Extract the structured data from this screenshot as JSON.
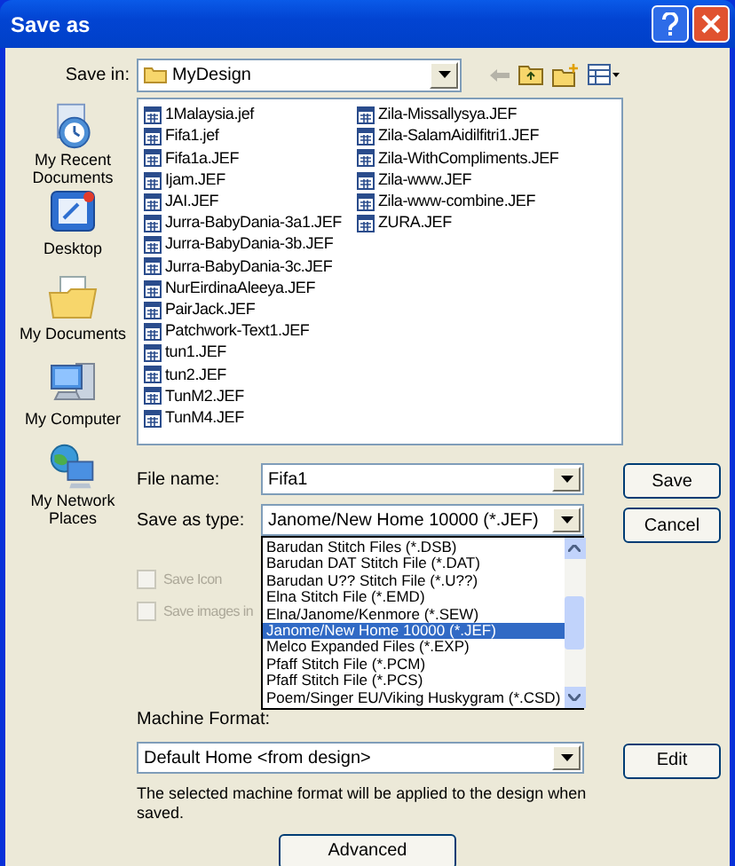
{
  "window": {
    "title": "Save as"
  },
  "save_in": {
    "label": "Save in:",
    "value": "MyDesign"
  },
  "places": [
    {
      "kind": "recent",
      "label": "My Recent Documents"
    },
    {
      "kind": "desktop",
      "label": "Desktop"
    },
    {
      "kind": "documents",
      "label": "My Documents"
    },
    {
      "kind": "computer",
      "label": "My Computer"
    },
    {
      "kind": "network",
      "label": "My Network Places"
    }
  ],
  "files": [
    "1Malaysia.jef",
    "Fifa1.jef",
    "Fifa1a.JEF",
    "Ijam.JEF",
    "JAI.JEF",
    "Jurra-BabyDania-3a1.JEF",
    "Jurra-BabyDania-3b.JEF",
    "Jurra-BabyDania-3c.JEF",
    "NurEirdinaAleeya.JEF",
    "PairJack.JEF",
    "Patchwork-Text1.JEF",
    "tun1.JEF",
    "tun2.JEF",
    "TunM2.JEF",
    "TunM4.JEF",
    "Zila-Missallysya.JEF",
    "Zila-SalamAidilfitri1.JEF",
    "Zila-WithCompliments.JEF",
    "Zila-www.JEF",
    "Zila-www-combine.JEF",
    "ZURA.JEF"
  ],
  "file_name": {
    "label": "File name:",
    "value": "Fifa1"
  },
  "save_as_type": {
    "label": "Save as type:",
    "value": "Janome/New Home 10000 (*.JEF)",
    "expanded": true,
    "options": [
      {
        "label": "Barudan Stitch Files (*.DSB)",
        "selected": false
      },
      {
        "label": "Barudan DAT Stitch File (*.DAT)",
        "selected": false
      },
      {
        "label": "Barudan U?? Stitch File (*.U??)",
        "selected": false
      },
      {
        "label": "Elna Stitch File (*.EMD)",
        "selected": false
      },
      {
        "label": "Elna/Janome/Kenmore (*.SEW)",
        "selected": false
      },
      {
        "label": "Janome/New Home 10000 (*.JEF)",
        "selected": true
      },
      {
        "label": "Melco Expanded Files (*.EXP)",
        "selected": false
      },
      {
        "label": "Pfaff Stitch File (*.PCM)",
        "selected": false
      },
      {
        "label": "Pfaff Stitch File (*.PCS)",
        "selected": false
      },
      {
        "label": "Poem/Singer EU/Viking Huskygram (*.CSD)",
        "selected": false
      }
    ]
  },
  "checkboxes": [
    {
      "label": "Save Icon",
      "checked": false,
      "disabled": true
    },
    {
      "label": "Save images in",
      "checked": false,
      "disabled": true
    }
  ],
  "machine_format": {
    "label": "Machine Format:",
    "value": "Default Home <from design>"
  },
  "note": "The selected machine format will be applied to the design when saved.",
  "buttons": {
    "save": "Save",
    "cancel": "Cancel",
    "edit": "Edit",
    "advanced": "Advanced"
  }
}
